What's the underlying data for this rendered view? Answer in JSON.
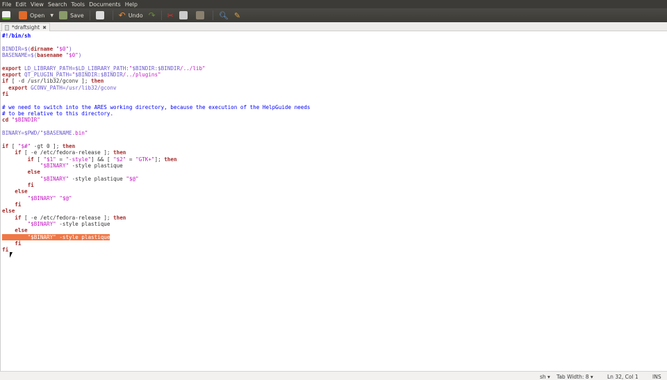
{
  "menu": [
    "File",
    "Edit",
    "View",
    "Search",
    "Tools",
    "Documents",
    "Help"
  ],
  "toolbar": {
    "open": "Open",
    "save": "Save",
    "undo": "Undo"
  },
  "tab": {
    "title": "*draftsight",
    "close": "✖"
  },
  "status": {
    "language": "sh ▾",
    "tab_width": "Tab Width: 8 ▾",
    "position": "Ln 32, Col 1",
    "mode": "INS"
  },
  "selected_line": 32,
  "code": {
    "lines": [
      [
        [
          "cb",
          "#!/bin/sh"
        ]
      ],
      [],
      [
        [
          "v",
          "BINDIR=$("
        ],
        [
          "k",
          "dirname"
        ],
        [
          "s",
          " \"$0\""
        ],
        [
          "v",
          ")"
        ]
      ],
      [
        [
          "v",
          "BASENAME=$("
        ],
        [
          "k",
          "basename"
        ],
        [
          "s",
          " \"$0\""
        ],
        [
          "v",
          ")"
        ]
      ],
      [],
      [
        [
          "k",
          "export"
        ],
        [
          "v",
          " LD_LIBRARY_PATH=$LD_LIBRARY_PATH:"
        ],
        [
          "s",
          "\""
        ],
        [
          "v",
          "$BINDIR:$BINDIR"
        ],
        [
          "s",
          "/../lib\""
        ]
      ],
      [
        [
          "k",
          "export"
        ],
        [
          "v",
          " QT_PLUGIN_PATH="
        ],
        [
          "s",
          "\""
        ],
        [
          "v",
          "$BINDIR:$BINDIR"
        ],
        [
          "s",
          "/../plugins\""
        ]
      ],
      [
        [
          "k",
          "if"
        ],
        [
          "p",
          " [ -d /usr/lib32/gconv ]; "
        ],
        [
          "k",
          "then"
        ]
      ],
      [
        [
          "p",
          "  "
        ],
        [
          "k",
          "export"
        ],
        [
          "v",
          " GCONV_PATH=/usr/lib32/gconv"
        ]
      ],
      [
        [
          "k",
          "fi"
        ]
      ],
      [],
      [
        [
          "c",
          "# we need to switch into the ARES working directory, because the execution of the HelpGuide needs"
        ]
      ],
      [
        [
          "c",
          "# to be relative to this directory."
        ]
      ],
      [
        [
          "k",
          "cd"
        ],
        [
          "s",
          " \"$BINDIR\""
        ]
      ],
      [],
      [
        [
          "v",
          "BINARY=$PWD/\"$BASENAME"
        ],
        [
          "s",
          ".bin\""
        ]
      ],
      [],
      [
        [
          "k",
          "if"
        ],
        [
          "p",
          " [ "
        ],
        [
          "s",
          "\"$#\""
        ],
        [
          "p",
          " -gt 0 ]; "
        ],
        [
          "k",
          "then"
        ]
      ],
      [
        [
          "p",
          "    "
        ],
        [
          "k",
          "if"
        ],
        [
          "p",
          " [ -e /etc/fedora-release ]; "
        ],
        [
          "k",
          "then"
        ]
      ],
      [
        [
          "p",
          "        "
        ],
        [
          "k",
          "if"
        ],
        [
          "p",
          " [ "
        ],
        [
          "s",
          "\"$1\""
        ],
        [
          "p",
          " = "
        ],
        [
          "s",
          "\"-style\""
        ],
        [
          "p",
          "] && [ "
        ],
        [
          "s",
          "\"$2\""
        ],
        [
          "p",
          " = "
        ],
        [
          "s",
          "\"GTK+\""
        ],
        [
          "p",
          "]; "
        ],
        [
          "k",
          "then"
        ]
      ],
      [
        [
          "p",
          "            "
        ],
        [
          "s",
          "\"$BINARY\""
        ],
        [
          "p",
          " -style plastique"
        ]
      ],
      [
        [
          "p",
          "        "
        ],
        [
          "k",
          "else"
        ]
      ],
      [
        [
          "p",
          "            "
        ],
        [
          "s",
          "\"$BINARY\""
        ],
        [
          "p",
          " -style plastique "
        ],
        [
          "s",
          "\"$@\""
        ]
      ],
      [
        [
          "p",
          "        "
        ],
        [
          "k",
          "fi"
        ]
      ],
      [
        [
          "p",
          "    "
        ],
        [
          "k",
          "else"
        ]
      ],
      [
        [
          "p",
          "        "
        ],
        [
          "s",
          "\"$BINARY\""
        ],
        [
          "p",
          " "
        ],
        [
          "s",
          "\"$@\""
        ]
      ],
      [
        [
          "p",
          "    "
        ],
        [
          "k",
          "fi"
        ]
      ],
      [
        [
          "k",
          "else"
        ]
      ],
      [
        [
          "p",
          "    "
        ],
        [
          "k",
          "if"
        ],
        [
          "p",
          " [ -e /etc/fedora-release ]; "
        ],
        [
          "k",
          "then"
        ]
      ],
      [
        [
          "p",
          "        "
        ],
        [
          "s",
          "\"$BINARY\""
        ],
        [
          "p",
          " -style plastique"
        ]
      ],
      [
        [
          "p",
          "    "
        ],
        [
          "k",
          "else"
        ]
      ],
      [
        [
          "p",
          "        "
        ],
        [
          "s",
          "\"$BINARY\""
        ],
        [
          "p",
          " -style plastique"
        ]
      ],
      [
        [
          "p",
          "    "
        ],
        [
          "k",
          "fi"
        ]
      ],
      [
        [
          "k",
          "fi"
        ]
      ]
    ]
  }
}
